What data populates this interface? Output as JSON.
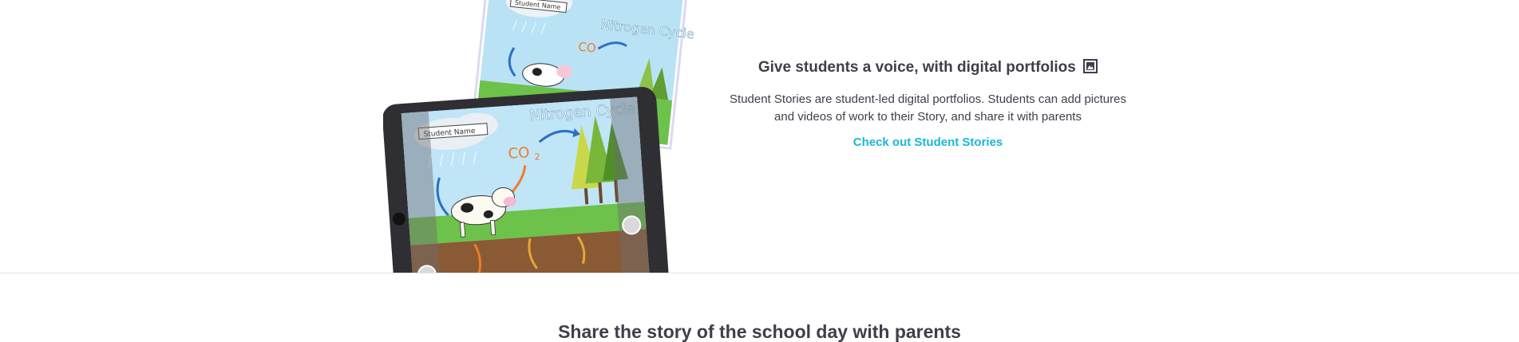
{
  "feature": {
    "title": "Give students a voice, with digital portfolios",
    "title_icon": "framed-picture-icon",
    "description_line1": "Student Stories are student-led digital portfolios. Students can add pictures",
    "description_line2": "and videos of work to their Story, and share it with parents",
    "link_label": "Check out Student Stories",
    "link_color": "#17b8d6",
    "illustration": {
      "back_page_title": "Nitrogen Cycle",
      "back_page_name": "Student Name",
      "tablet_title": "Nitrogen Cycle",
      "tablet_name": "Student Name",
      "formula": "CO",
      "formula_sub": "2"
    }
  },
  "next_section": {
    "heading": "Share the story of the school day with parents"
  }
}
